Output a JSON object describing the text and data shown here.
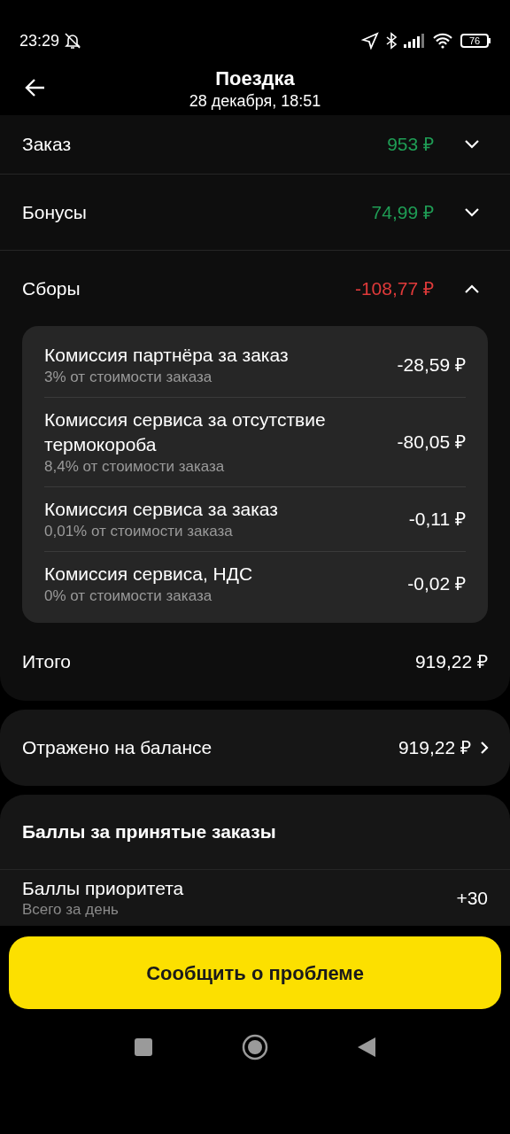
{
  "status_bar": {
    "time": "23:29",
    "battery": "76"
  },
  "header": {
    "title": "Поездка",
    "subtitle": "28 декабря, 18:51"
  },
  "sections": [
    {
      "label": "Заказ",
      "amount": "953 ₽",
      "color": "#1f9d55",
      "expanded": false
    },
    {
      "label": "Бонусы",
      "amount": "74,99 ₽",
      "color": "#1f9d55",
      "expanded": false
    },
    {
      "label": "Сборы",
      "amount": "-108,77 ₽",
      "color": "#e03a3a",
      "expanded": true,
      "items": [
        {
          "title": "Комиссия партнёра за заказ",
          "note": "3% от стоимости заказа",
          "amount": "-28,59 ₽"
        },
        {
          "title": "Комиссия сервиса за отсутствие термокороба",
          "note": "8,4% от стоимости заказа",
          "amount": "-80,05 ₽"
        },
        {
          "title": "Комиссия сервиса за заказ",
          "note": "0,01% от стоимости заказа",
          "amount": "-0,11 ₽"
        },
        {
          "title": "Комиссия сервиса, НДС",
          "note": "0% от стоимости заказа",
          "amount": "-0,02 ₽"
        }
      ]
    }
  ],
  "total": {
    "label": "Итого",
    "amount": "919,22 ₽"
  },
  "balance": {
    "label": "Отражено на балансе",
    "amount": "919,22 ₽"
  },
  "points": {
    "title": "Баллы за принятые заказы",
    "rows": [
      {
        "label": "Баллы приоритета",
        "note": "Всего за день",
        "value": "+30"
      }
    ]
  },
  "report_button": "Сообщить о проблеме"
}
